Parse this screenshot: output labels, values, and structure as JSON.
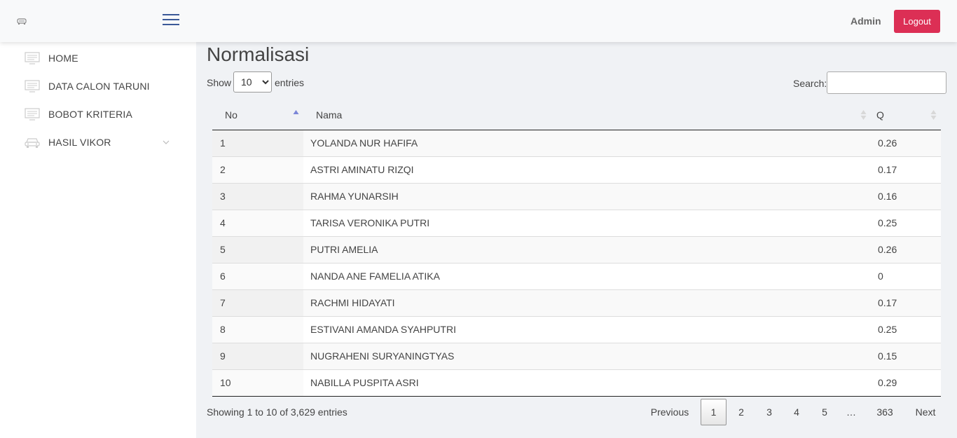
{
  "header": {
    "admin_label": "Admin",
    "logout_label": "Logout"
  },
  "sidebar": {
    "items": [
      {
        "label": "HOME",
        "icon": "monitor-icon"
      },
      {
        "label": "DATA CALON TARUNI",
        "icon": "monitor-icon"
      },
      {
        "label": "BOBOT KRITERIA",
        "icon": "monitor-icon"
      },
      {
        "label": "HASIL VIKOR",
        "icon": "car-icon"
      }
    ]
  },
  "page": {
    "title": "Normalisasi"
  },
  "controls": {
    "show_label": "Show",
    "entries_value": "10",
    "entries_options": [
      "10"
    ],
    "entries_label": "entries",
    "search_label": "Search:",
    "search_value": ""
  },
  "table": {
    "columns": [
      "No",
      "Nama",
      "Q"
    ],
    "sorted_column": "No",
    "sort_direction": "ascending",
    "rows": [
      {
        "no": "1",
        "nama": "YOLANDA NUR HAFIFA",
        "q": "0.26"
      },
      {
        "no": "2",
        "nama": "ASTRI AMINATU RIZQI",
        "q": "0.17"
      },
      {
        "no": "3",
        "nama": "RAHMA YUNARSIH",
        "q": "0.16"
      },
      {
        "no": "4",
        "nama": "TARISA VERONIKA PUTRI",
        "q": "0.25"
      },
      {
        "no": "5",
        "nama": "PUTRI AMELIA",
        "q": "0.26"
      },
      {
        "no": "6",
        "nama": "NANDA ANE FAMELIA ATIKA",
        "q": "0"
      },
      {
        "no": "7",
        "nama": "RACHMI HIDAYATI",
        "q": "0.17"
      },
      {
        "no": "8",
        "nama": "ESTIVANI AMANDA SYAHPUTRI",
        "q": "0.25"
      },
      {
        "no": "9",
        "nama": "NUGRAHENI SURYANINGTYAS",
        "q": "0.15"
      },
      {
        "no": "10",
        "nama": "NABILLA PUSPITA ASRI",
        "q": "0.29"
      }
    ]
  },
  "footer": {
    "info": "Showing 1 to 10 of 3,629 entries",
    "pagination": {
      "previous": "Previous",
      "pages": [
        "1",
        "2",
        "3",
        "4",
        "5",
        "…",
        "363"
      ],
      "current_page": "1",
      "next": "Next"
    }
  },
  "colors": {
    "accent": "#dc2f55",
    "hamburger": "#3b5998",
    "sort_active": "#7b86d8"
  }
}
